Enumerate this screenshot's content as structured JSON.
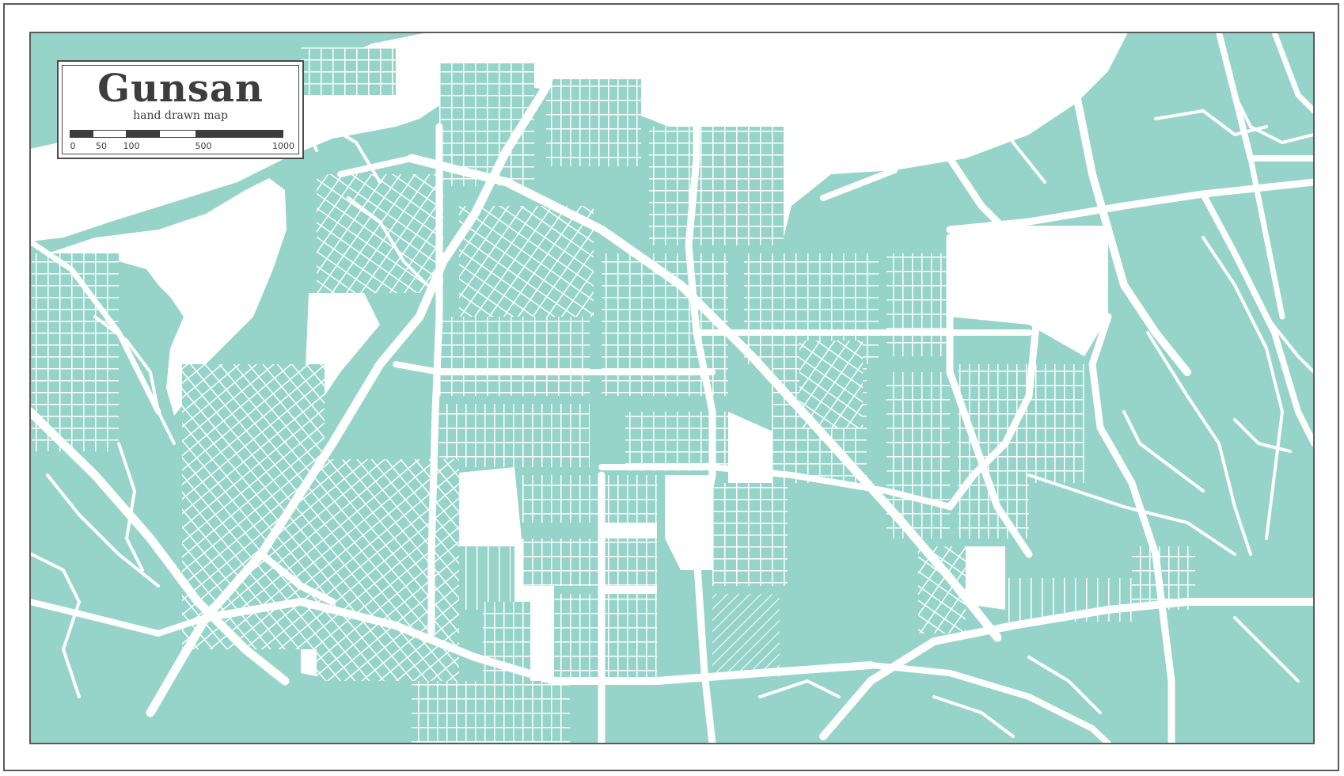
{
  "map": {
    "title": "Gunsan",
    "subtitle": "hand drawn map",
    "scale_labels": [
      "0",
      "50",
      "100",
      "500",
      "1000"
    ],
    "colors": {
      "land": "#96d4ca",
      "roads": "#ffffff",
      "water": "#ffffff",
      "frame": "#5a5a5a",
      "text": "#3d3d3d"
    }
  }
}
